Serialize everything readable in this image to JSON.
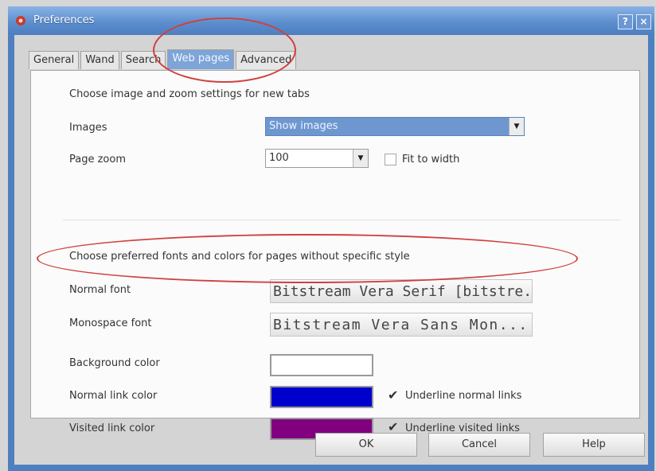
{
  "window": {
    "title": "Preferences",
    "help_label": "?",
    "close_label": "×"
  },
  "tabs": [
    "General",
    "Wand",
    "Search",
    "Web pages",
    "Advanced"
  ],
  "active_tab": "Web pages",
  "section1": {
    "heading": "Choose image and zoom settings for new tabs",
    "images_label": "Images",
    "images_value": "Show images",
    "zoom_label": "Page zoom",
    "zoom_value": "100",
    "fit_label": "Fit to width",
    "fit_checked": false
  },
  "section2": {
    "heading": "Choose preferred fonts and colors for pages without specific style",
    "normal_font_label": "Normal font",
    "normal_font_value": "Bitstream Vera Serif [bitstre...",
    "mono_font_label": "Monospace font",
    "mono_font_value": "Bitstream Vera Sans Mon...",
    "bg_label": "Background color",
    "bg_color": "#ffffff",
    "normal_link_label": "Normal link color",
    "normal_link_color": "#0000cc",
    "underline_normal_label": "Underline normal links",
    "underline_normal_checked": true,
    "visited_link_label": "Visited link color",
    "visited_link_color": "#800080",
    "underline_visited_label": "Underline visited links",
    "underline_visited_checked": true
  },
  "buttons": {
    "ok": "OK",
    "cancel": "Cancel",
    "help": "Help"
  },
  "annotation_color": "#d0403f"
}
